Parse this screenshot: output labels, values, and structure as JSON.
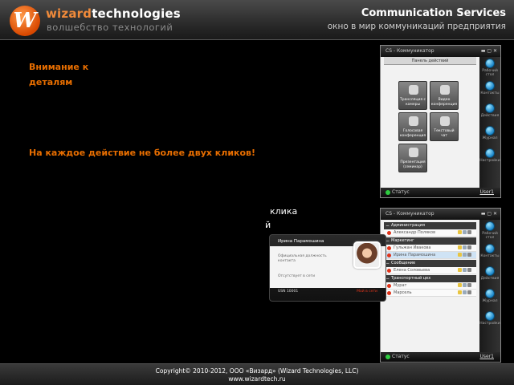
{
  "header": {
    "logo_letter": "W",
    "brand_part1": "wizard",
    "brand_part2": "technologies",
    "brand_sub": "волшебство технологий",
    "right_title": "Communication Services",
    "right_sub": "окно в мир коммуникаций предприятия"
  },
  "content": {
    "notice_line": "Внимание к деталям",
    "rule_line": "На каждое действие не более двух кликов!",
    "click_fragment": "клика",
    "fragment2": "й"
  },
  "window1": {
    "title": "CS - Коммуникатор",
    "panel_title": "Панель действий",
    "tiles": [
      {
        "label": "Трансляция с камеры"
      },
      {
        "label": "Видео конференция"
      },
      {
        "label": "Голосовая конференция"
      },
      {
        "label": "Текстовый чат"
      },
      {
        "label": "Презентация (семинар)"
      }
    ],
    "sidebar": [
      "Рабочий стол",
      "Контакты",
      "Действия",
      "Журнал",
      "Настройки"
    ],
    "status": "Статус",
    "user": "User1"
  },
  "window2": {
    "title": "CS - Коммуникатор",
    "groups": [
      {
        "name": "Администрация",
        "rows": [
          "Александр Поляков"
        ]
      },
      {
        "name": "Маркетинг",
        "rows": [
          "Гульжан Ивакова",
          "Ирина Парамошина"
        ]
      },
      {
        "name": "Сообщение",
        "rows": [
          "Елена Соловьева"
        ]
      },
      {
        "name": "Транспортный цех",
        "rows": [
          "Мурат",
          "Марсель"
        ]
      }
    ],
    "sidebar": [
      "Рабочий стол",
      "Контакты",
      "Действия",
      "Журнал",
      "Настройки"
    ],
    "status": "Статус",
    "user": "User1"
  },
  "card": {
    "name": "Ирина Парамошина",
    "job": "Официальная должность контакта",
    "status": "Отсутствует в сети",
    "ext": "USN 10001",
    "link": "Мой в сети"
  },
  "footer": {
    "line1": "Copyright© 2010-2012, ООО «Визард» (Wizard Technologies, LLC)",
    "line2": "www.wizardtech.ru"
  },
  "colors": {
    "accent": "#e86e00",
    "offline": "#e0341a",
    "sidebar_icon": "#1a85c9"
  }
}
